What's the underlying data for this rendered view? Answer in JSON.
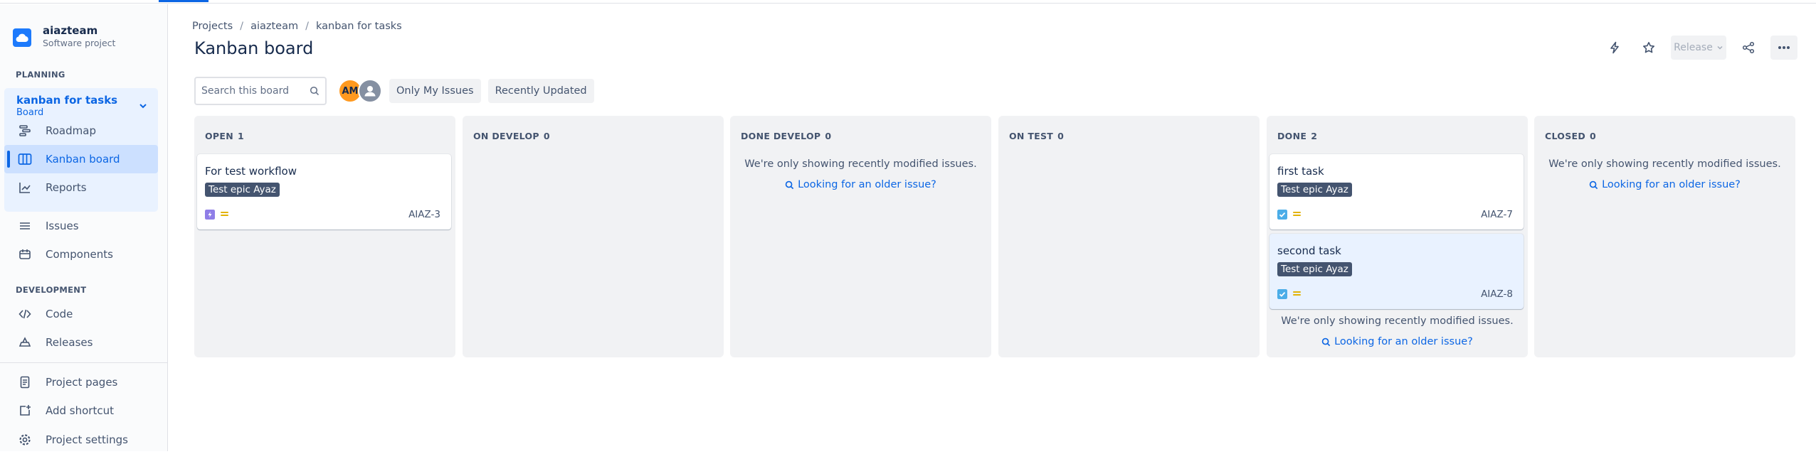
{
  "project": {
    "name": "aiazteam",
    "type": "Software project"
  },
  "sidebar": {
    "planning_label": "PLANNING",
    "board": {
      "title": "kanban for tasks",
      "subtitle": "Board"
    },
    "planning_items": [
      {
        "label": "Roadmap",
        "icon": "roadmap-icon"
      },
      {
        "label": "Kanban board",
        "icon": "board-icon",
        "selected": true
      },
      {
        "label": "Reports",
        "icon": "reports-icon"
      }
    ],
    "other_items": [
      {
        "label": "Issues",
        "icon": "issues-icon"
      },
      {
        "label": "Components",
        "icon": "components-icon"
      }
    ],
    "development_label": "DEVELOPMENT",
    "dev_items": [
      {
        "label": "Code",
        "icon": "code-icon"
      },
      {
        "label": "Releases",
        "icon": "releases-icon"
      }
    ],
    "bottom_items": [
      {
        "label": "Project pages",
        "icon": "pages-icon"
      },
      {
        "label": "Add shortcut",
        "icon": "add-shortcut-icon"
      },
      {
        "label": "Project settings",
        "icon": "settings-icon"
      }
    ]
  },
  "breadcrumbs": [
    "Projects",
    "aiazteam",
    "kanban for tasks"
  ],
  "page_title": "Kanban board",
  "actions": {
    "release_label": "Release"
  },
  "toolbar": {
    "search_placeholder": "Search this board",
    "avatar_initials": "AM",
    "filters": [
      "Only My Issues",
      "Recently Updated"
    ]
  },
  "messages": {
    "recent_only": "We're only showing recently modified issues.",
    "older_link": "Looking for an older issue?"
  },
  "columns": [
    {
      "name": "OPEN",
      "count": "1",
      "cards": [
        {
          "title": "For test workflow",
          "epic": "Test epic Ayaz",
          "key": "AIAZ-3",
          "type": "epic",
          "type_color": "#8f7ee7"
        }
      ]
    },
    {
      "name": "ON DEVELOP",
      "count": "0",
      "cards": []
    },
    {
      "name": "DONE DEVELOP",
      "count": "0",
      "cards": []
    },
    {
      "name": "ON TEST",
      "count": "0",
      "cards": []
    },
    {
      "name": "DONE",
      "count": "2",
      "cards": [
        {
          "title": "first task",
          "epic": "Test epic Ayaz",
          "key": "AIAZ-7",
          "type": "task",
          "type_color": "#4bade8"
        },
        {
          "title": "second task",
          "epic": "Test epic Ayaz",
          "key": "AIAZ-8",
          "type": "task",
          "type_color": "#4bade8"
        }
      ]
    },
    {
      "name": "CLOSED",
      "count": "0",
      "cards": []
    }
  ],
  "colors": {
    "accent": "#0c66e4",
    "priority_medium": "#e2b203",
    "column_bg": "#f1f2f4"
  }
}
